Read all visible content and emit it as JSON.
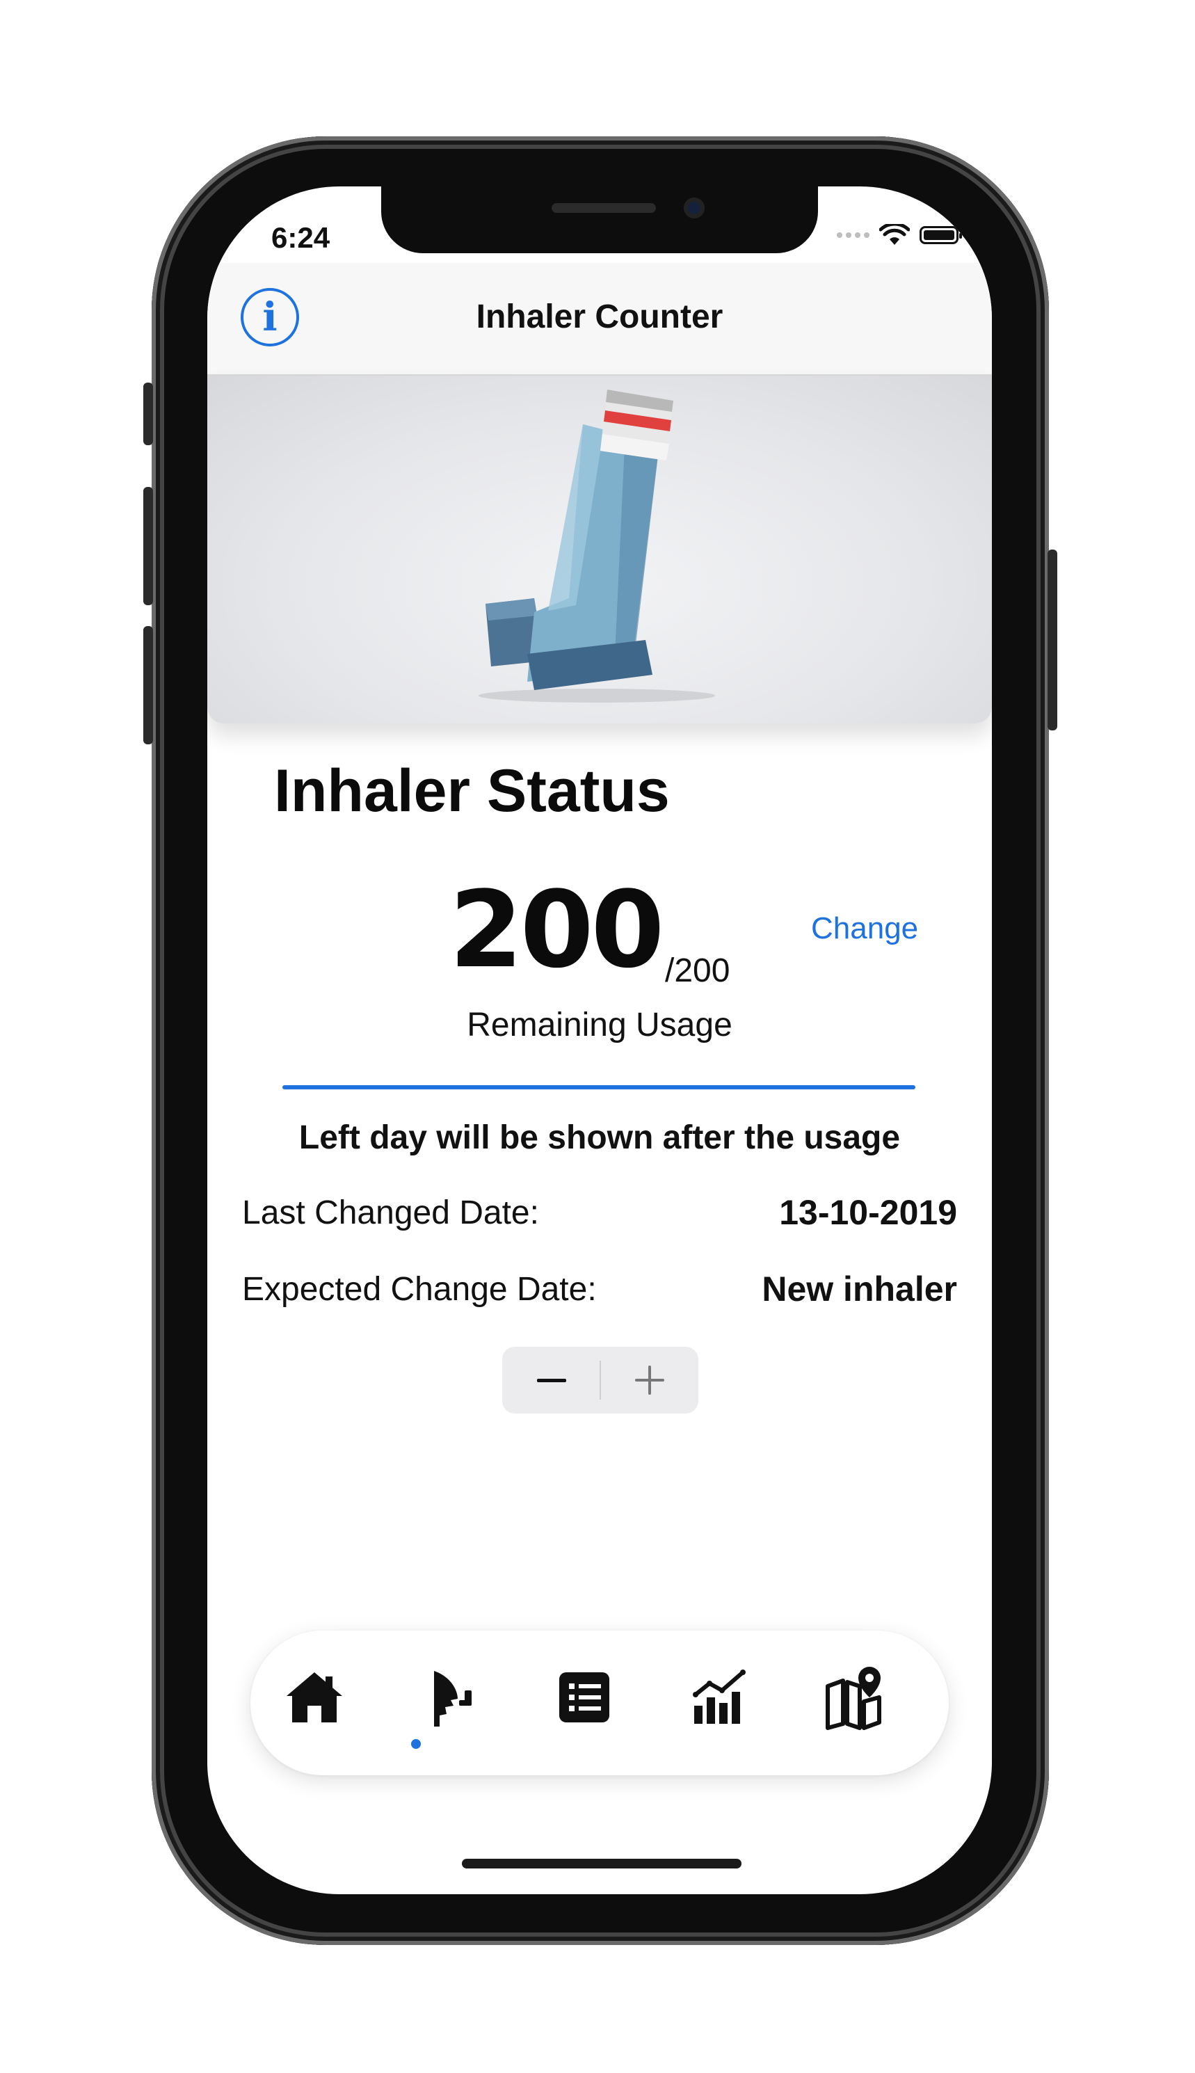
{
  "status_bar": {
    "time": "6:24"
  },
  "navbar": {
    "title": "Inhaler Counter",
    "info_glyph": "i"
  },
  "inhaler_status": {
    "title": "Inhaler Status",
    "remaining": "200",
    "total": "/200",
    "remaining_label": "Remaining Usage",
    "change_label": "Change",
    "progress_fraction": 1.0,
    "left_day_message": "Left day will be shown after the usage",
    "last_changed_label": "Last Changed Date:",
    "last_changed_value": "13-10-2019",
    "expected_change_label": "Expected Change Date:",
    "expected_change_value": "New inhaler"
  },
  "tabbar": {
    "items": [
      {
        "icon": "home-icon",
        "active": false
      },
      {
        "icon": "inhaler-person-icon",
        "active": true
      },
      {
        "icon": "list-icon",
        "active": false
      },
      {
        "icon": "chart-icon",
        "active": false
      },
      {
        "icon": "map-pin-icon",
        "active": false
      }
    ]
  },
  "colors": {
    "accent": "#1e72e0",
    "text": "#111111",
    "background": "#ffffff"
  }
}
